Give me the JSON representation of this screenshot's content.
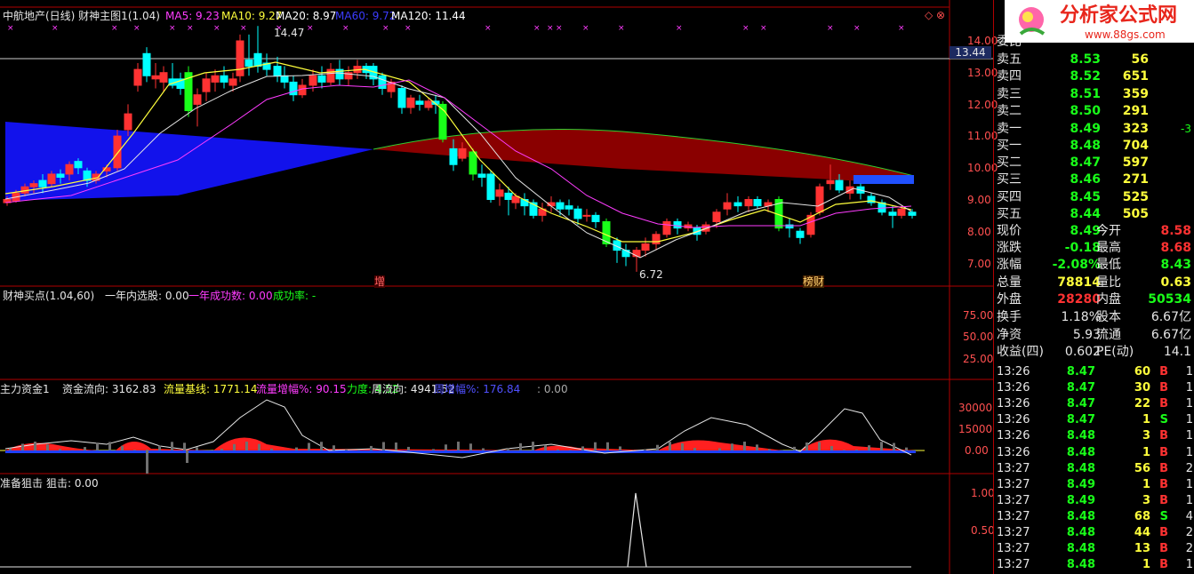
{
  "main_panel": {
    "title": "中航地产(日线) 财神主图1(1.04)",
    "ma": [
      {
        "label": "MA5: 9.23",
        "color": "#ff3cff"
      },
      {
        "label": "MA10: 9.27",
        "color": "#ffff3c"
      },
      {
        "label": "MA20: 8.97",
        "color": "#ffffff"
      },
      {
        "label": "MA60: 9.72",
        "color": "#3c3cff"
      },
      {
        "label": "MA120: 11.44",
        "color": "#ffffff"
      }
    ],
    "high_label": "14.47",
    "low_label": "6.72",
    "markers": [
      "增",
      "榜财"
    ],
    "price_axis": [
      "14.00",
      "13.00",
      "12.00",
      "11.00",
      "10.00",
      "9.00",
      "8.00",
      "7.00"
    ],
    "crosshair_price": "13.44"
  },
  "panel2": {
    "title": "财神买点(1.04,60)",
    "fields": [
      "一年内选股: 0.00",
      "一年成功数: 0.00",
      "成功率: -"
    ],
    "axis": [
      "75.00",
      "50.00",
      "25.00"
    ]
  },
  "panel3": {
    "title": "主力资金1",
    "fields": [
      {
        "label": "资金流向: 3162.83",
        "color": "#e6e6e6"
      },
      {
        "label": "流量基线: 1771.14",
        "color": "#ffff3c"
      },
      {
        "label": "流量增幅%: 90.15",
        "color": "#ff3cff"
      },
      {
        "label": "力度: 4.52",
        "color": "#19ff19"
      },
      {
        "label": "周流向: 4941.52",
        "color": "#e6e6e6"
      },
      {
        "label": "周增幅%: 176.84",
        "color": "#5050ff"
      },
      {
        "label": ": 0.00",
        "color": "#aaaaaa"
      }
    ],
    "axis": [
      "30000",
      "15000",
      "0.00"
    ]
  },
  "panel4": {
    "title": "准备狙击",
    "fields": [
      "狙击: 0.00"
    ],
    "axis": [
      "1.00",
      "0.50"
    ]
  },
  "quote": {
    "header": "委比",
    "asks": [
      {
        "label": "卖五",
        "price": "8.53",
        "vol": "56"
      },
      {
        "label": "卖四",
        "price": "8.52",
        "vol": "651"
      },
      {
        "label": "卖三",
        "price": "8.51",
        "vol": "359"
      },
      {
        "label": "卖二",
        "price": "8.50",
        "vol": "291"
      },
      {
        "label": "卖一",
        "price": "8.49",
        "vol": "323",
        "diff": "-3"
      }
    ],
    "bids": [
      {
        "label": "买一",
        "price": "8.48",
        "vol": "704"
      },
      {
        "label": "买二",
        "price": "8.47",
        "vol": "597"
      },
      {
        "label": "买三",
        "price": "8.46",
        "vol": "271"
      },
      {
        "label": "买四",
        "price": "8.45",
        "vol": "525"
      },
      {
        "label": "买五",
        "price": "8.44",
        "vol": "505"
      }
    ],
    "stats": [
      {
        "l1": "现价",
        "v1": "8.49",
        "c1": "g",
        "l2": "今开",
        "v2": "8.58",
        "c2": "r"
      },
      {
        "l1": "涨跌",
        "v1": "-0.18",
        "c1": "g",
        "l2": "最高",
        "v2": "8.68",
        "c2": "r"
      },
      {
        "l1": "涨幅",
        "v1": "-2.08%",
        "c1": "g",
        "l2": "最低",
        "v2": "8.43",
        "c2": "g"
      },
      {
        "l1": "总量",
        "v1": "78814",
        "c1": "y",
        "l2": "量比",
        "v2": "0.63",
        "c2": "y"
      },
      {
        "l1": "外盘",
        "v1": "28280",
        "c1": "r",
        "l2": "内盘",
        "v2": "50534",
        "c2": "g"
      }
    ],
    "stats2": [
      {
        "l1": "换手",
        "v1": "1.18%",
        "l2": "股本",
        "v2": "6.67亿"
      },
      {
        "l1": "净资",
        "v1": "5.93",
        "l2": "流通",
        "v2": "6.67亿"
      },
      {
        "l1": "收益(四)",
        "v1": "0.602",
        "l2": "PE(动)",
        "v2": "14.1"
      }
    ]
  },
  "ticks": [
    {
      "t": "13:26",
      "p": "8.47",
      "v": "60",
      "s": "B",
      "n": "1"
    },
    {
      "t": "13:26",
      "p": "8.47",
      "v": "30",
      "s": "B",
      "n": "1"
    },
    {
      "t": "13:26",
      "p": "8.47",
      "v": "22",
      "s": "B",
      "n": "1"
    },
    {
      "t": "13:26",
      "p": "8.47",
      "v": "1",
      "s": "S",
      "n": "1"
    },
    {
      "t": "13:26",
      "p": "8.48",
      "v": "3",
      "s": "B",
      "n": "1"
    },
    {
      "t": "13:26",
      "p": "8.48",
      "v": "1",
      "s": "B",
      "n": "1"
    },
    {
      "t": "13:27",
      "p": "8.48",
      "v": "56",
      "s": "B",
      "n": "2"
    },
    {
      "t": "13:27",
      "p": "8.49",
      "v": "1",
      "s": "B",
      "n": "1"
    },
    {
      "t": "13:27",
      "p": "8.49",
      "v": "3",
      "s": "B",
      "n": "1"
    },
    {
      "t": "13:27",
      "p": "8.48",
      "v": "68",
      "s": "S",
      "n": "4"
    },
    {
      "t": "13:27",
      "p": "8.48",
      "v": "44",
      "s": "B",
      "n": "2"
    },
    {
      "t": "13:27",
      "p": "8.48",
      "v": "13",
      "s": "B",
      "n": "2"
    },
    {
      "t": "13:27",
      "p": "8.48",
      "v": "1",
      "s": "B",
      "n": "1"
    }
  ],
  "logo": {
    "text": "分析家公式网",
    "url_text": "www.88gs.com"
  },
  "colors": {
    "up": "#ff3232",
    "down": "#00ffff",
    "green_bar": "#19ff19",
    "grid": "#b00000"
  }
}
